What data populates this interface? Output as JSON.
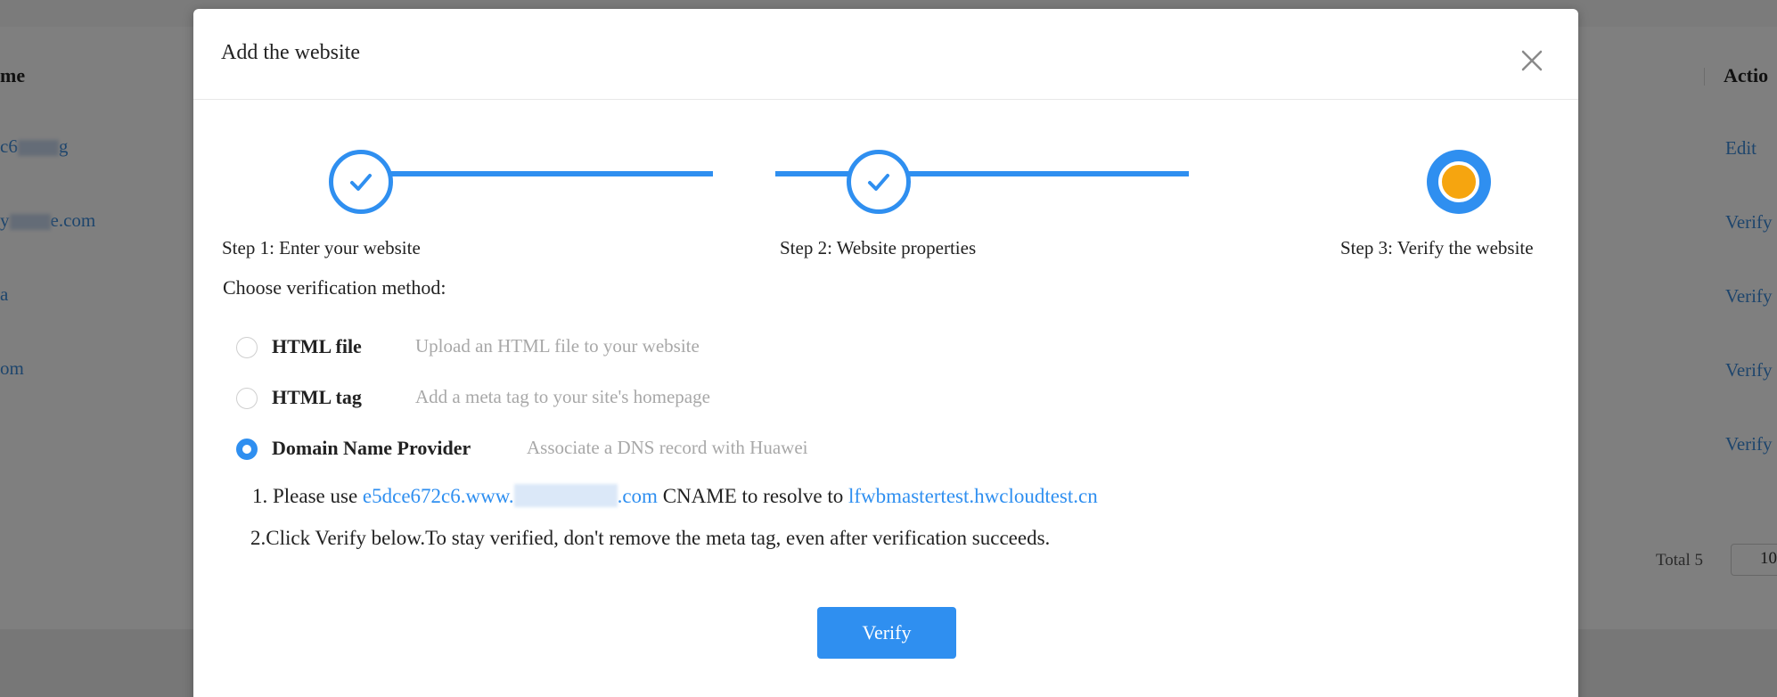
{
  "background": {
    "col_name": "me",
    "col_action": "Actio",
    "rows": [
      {
        "name_prefix": "c6",
        "name_suffix": "g",
        "action": "Edit"
      },
      {
        "name_prefix": "y",
        "name_suffix": "e.com",
        "action": "Verify"
      },
      {
        "name_prefix": "a",
        "name_suffix": "",
        "action": "Verify"
      },
      {
        "name_prefix": "om",
        "name_suffix": "",
        "action": "Verify"
      },
      {
        "name_prefix": "",
        "name_suffix": "",
        "action": "Verify"
      }
    ],
    "total": "Total 5",
    "page_size": "10"
  },
  "modal": {
    "title": "Add the website",
    "steps": [
      {
        "label": "Step 1: Enter your website",
        "status": "done"
      },
      {
        "label": "Step 2: Website properties",
        "status": "done"
      },
      {
        "label": "Step 3: Verify the website",
        "status": "active"
      }
    ],
    "choose_label": "Choose verification method:",
    "methods": [
      {
        "name": "HTML file",
        "desc": "Upload an HTML file to your website",
        "checked": false
      },
      {
        "name": "HTML tag",
        "desc": "Add a meta tag to your site's homepage",
        "checked": false
      },
      {
        "name": "Domain Name Provider",
        "desc": "Associate a DNS record with Huawei",
        "checked": true
      }
    ],
    "instruction1": {
      "prefix": "1. Please use ",
      "host_start": "e5dce672c6.www.",
      "host_end": ".com",
      "middle": " CNAME to resolve to ",
      "target": "lfwbmastertest.hwcloudtest.cn"
    },
    "instruction2": "2.Click Verify below.To stay verified, don't remove the meta tag, even after verification succeeds.",
    "verify_label": "Verify"
  },
  "colors": {
    "accent": "#2f8ff0",
    "active_dot": "#f6a50f",
    "overlay": "rgba(0,0,0,0.5)"
  }
}
